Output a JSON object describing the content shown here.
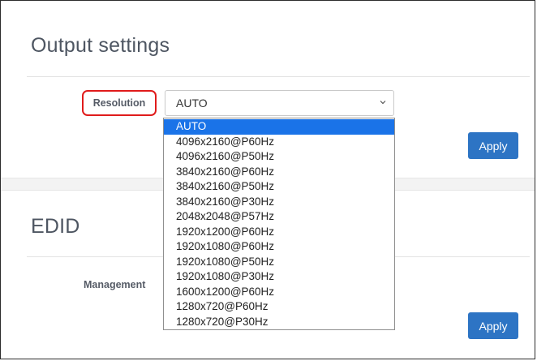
{
  "output": {
    "title": "Output settings",
    "resolution_label": "Resolution",
    "resolution_value": "AUTO",
    "resolution_options": [
      "AUTO",
      "4096x2160@P60Hz",
      "4096x2160@P50Hz",
      "3840x2160@P60Hz",
      "3840x2160@P50Hz",
      "3840x2160@P30Hz",
      "2048x2048@P57Hz",
      "1920x1200@P60Hz",
      "1920x1080@P60Hz",
      "1920x1080@P50Hz",
      "1920x1080@P30Hz",
      "1600x1200@P60Hz",
      "1280x720@P60Hz",
      "1280x720@P30Hz"
    ],
    "apply_label": "Apply"
  },
  "edid": {
    "title": "EDID",
    "management_label": "Management",
    "apply_label": "Apply"
  },
  "colors": {
    "highlight_border": "#e01b1b",
    "selected_option_bg": "#1a73e8",
    "apply_button_bg": "#2d74c4"
  }
}
